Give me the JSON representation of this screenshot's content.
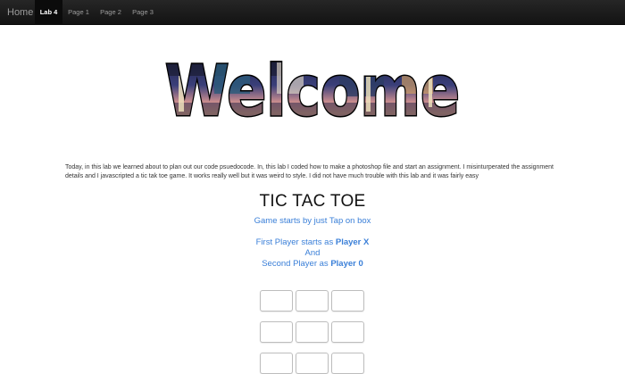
{
  "navbar": {
    "brand": "Home",
    "items": [
      {
        "label": "Lab 4",
        "active": true
      },
      {
        "label": "Page 1",
        "active": false
      },
      {
        "label": "Page 2",
        "active": false
      },
      {
        "label": "Page 3",
        "active": false
      }
    ]
  },
  "hero": {
    "title": "Welcome"
  },
  "intro_text": "Today, in this lab we learned about to plan out our code psuedocode. In, this lab I coded how to make a photoshop file and start an assignment. I misinturperated the assignment details and I javascripted a tic tak toe game. It works really well but it was weird to style. I did not have much trouble with this lab and it was fairly easy",
  "game": {
    "title": "TIC TAC TOE",
    "instructions": "Game starts by just Tap on box",
    "first_prefix": "First Player starts as ",
    "first_player": "Player X",
    "and_text": "And",
    "second_prefix": "Second Player as ",
    "second_player": "Player 0",
    "board": [
      "",
      "",
      "",
      "",
      "",
      "",
      "",
      "",
      ""
    ]
  },
  "colors": {
    "link_blue": "#3a7fd8",
    "navbar_bg": "#222222"
  }
}
